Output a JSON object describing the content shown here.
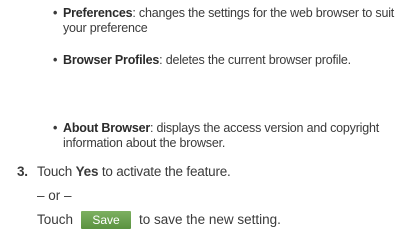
{
  "bullets": [
    {
      "term": "Preferences",
      "desc": ": changes the settings for the web browser to suit your preference"
    },
    {
      "term": "Browser Profiles",
      "desc": ": deletes the current browser profile."
    },
    {
      "term": "About Browser",
      "desc": ": displays the access version and copyright information about the browser."
    }
  ],
  "step3": {
    "number": "3.",
    "before": "Touch ",
    "keyword": "Yes",
    "after": " to activate the feature."
  },
  "or_text": "– or –",
  "touch_line": {
    "before": "Touch",
    "button_label": "Save",
    "after": "to save the new setting."
  }
}
